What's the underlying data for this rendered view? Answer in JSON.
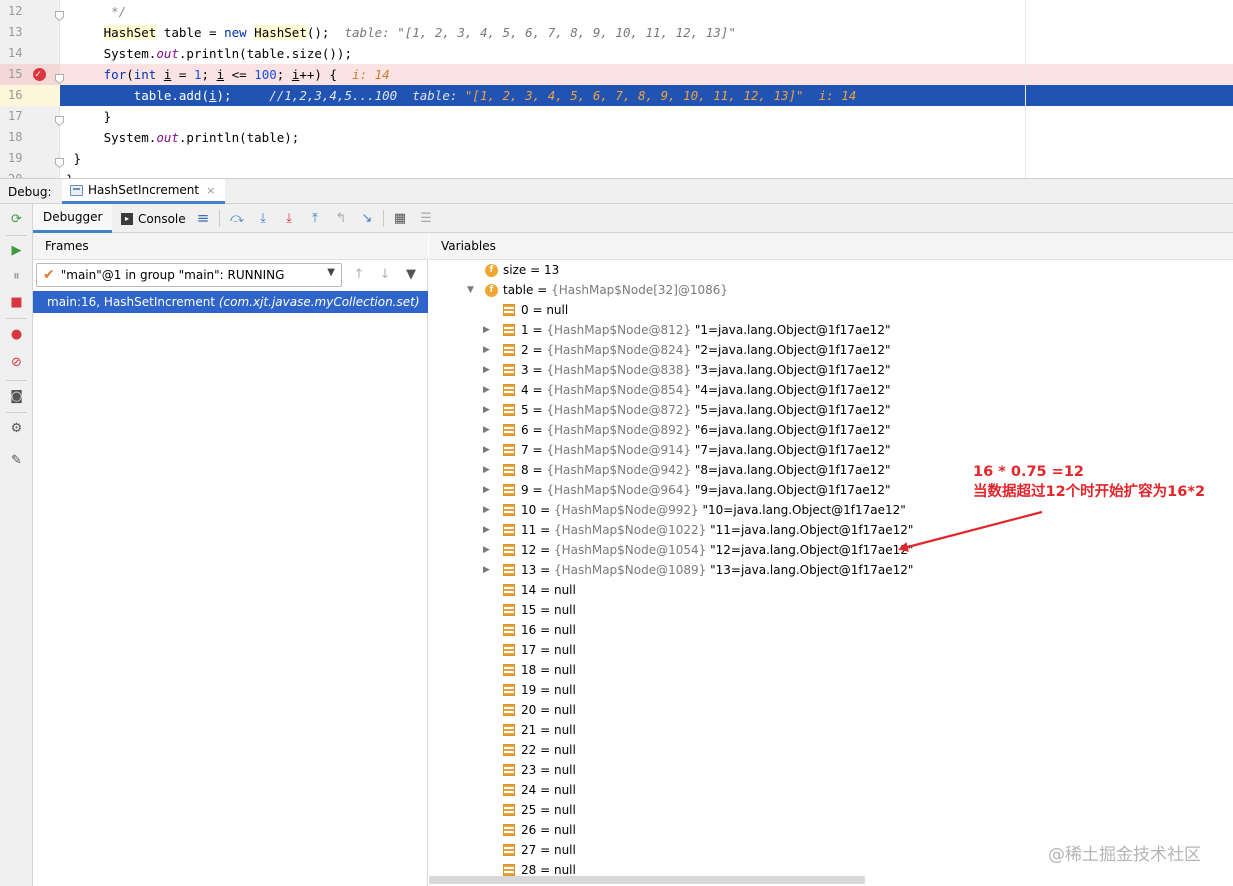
{
  "editor": {
    "lines": [
      {
        "num": "12",
        "parts": [
          {
            "t": "      */",
            "c": "cm"
          }
        ]
      },
      {
        "num": "13",
        "parts": [
          {
            "t": "     "
          },
          {
            "t": "HashSet",
            "c": "ty"
          },
          {
            "t": " table = "
          },
          {
            "t": "new",
            "c": "kw"
          },
          {
            "t": " "
          },
          {
            "t": "HashSet",
            "c": "ty"
          },
          {
            "t": "();  "
          },
          {
            "t": "table: ",
            "c": "hint"
          },
          {
            "t": "\"[1, 2, 3, 4, 5, 6, 7, 8, 9, 10, 11, 12, 13]\"",
            "c": "hint"
          }
        ]
      },
      {
        "num": "14",
        "parts": [
          {
            "t": "     System."
          },
          {
            "t": "out",
            "c": "fld"
          },
          {
            "t": ".println(table.size());"
          }
        ]
      },
      {
        "num": "15",
        "parts": [
          {
            "t": "     "
          },
          {
            "t": "for",
            "c": "kw"
          },
          {
            "t": "("
          },
          {
            "t": "int",
            "c": "kw"
          },
          {
            "t": " "
          },
          {
            "t": "i",
            "c": "uvar"
          },
          {
            "t": " = "
          },
          {
            "t": "1",
            "c": "num"
          },
          {
            "t": "; "
          },
          {
            "t": "i",
            "c": "uvar"
          },
          {
            "t": " <= "
          },
          {
            "t": "100",
            "c": "num"
          },
          {
            "t": "; "
          },
          {
            "t": "i",
            "c": "uvar"
          },
          {
            "t": "++) {  "
          },
          {
            "t": "i: 14",
            "c": "hint-i"
          }
        ]
      },
      {
        "num": "16",
        "parts": [
          {
            "t": "         table.add("
          },
          {
            "t": "i",
            "c": "uvar"
          },
          {
            "t": ");     "
          },
          {
            "t": "//1,2,3,4,5...100",
            "c": "cm"
          },
          {
            "t": "  "
          },
          {
            "t": "table: ",
            "c": "hint"
          },
          {
            "t": "\"[1, 2, 3, 4, 5, 6, 7, 8, 9, 10, 11, 12, 13]\"",
            "c": "hintv"
          },
          {
            "t": "  "
          },
          {
            "t": "i: 14",
            "c": "hint-i"
          }
        ]
      },
      {
        "num": "17",
        "parts": [
          {
            "t": "     }"
          }
        ]
      },
      {
        "num": "18",
        "parts": [
          {
            "t": "     System."
          },
          {
            "t": "out",
            "c": "fld"
          },
          {
            "t": ".println(table);"
          }
        ]
      },
      {
        "num": "19",
        "parts": [
          {
            "t": " }"
          }
        ]
      },
      {
        "num": "20",
        "parts": [
          {
            "t": "}"
          }
        ]
      }
    ]
  },
  "debug": {
    "title": "Debug:",
    "session_tab": "HashSetIncrement",
    "close_glyph": "×",
    "tabs": {
      "debugger": "Debugger",
      "console": "Console"
    }
  },
  "frames": {
    "title": "Frames",
    "thread": "\"main\"@1 in group \"main\": RUNNING",
    "frame_method": "main:16, HashSetIncrement ",
    "frame_package": "(com.xjt.javase.myCollection.set)"
  },
  "variables": {
    "title": "Variables",
    "size": {
      "name": "size",
      "eq": " = ",
      "value": "13"
    },
    "table": {
      "name": "table",
      "eq": " = ",
      "type": "{HashMap$Node[32]@1086}"
    },
    "entries": [
      {
        "name": "0",
        "value": "null"
      },
      {
        "name": "1",
        "type": "{HashMap$Node@812}",
        "value": "\"1=java.lang.Object@1f17ae12\""
      },
      {
        "name": "2",
        "type": "{HashMap$Node@824}",
        "value": "\"2=java.lang.Object@1f17ae12\""
      },
      {
        "name": "3",
        "type": "{HashMap$Node@838}",
        "value": "\"3=java.lang.Object@1f17ae12\""
      },
      {
        "name": "4",
        "type": "{HashMap$Node@854}",
        "value": "\"4=java.lang.Object@1f17ae12\""
      },
      {
        "name": "5",
        "type": "{HashMap$Node@872}",
        "value": "\"5=java.lang.Object@1f17ae12\""
      },
      {
        "name": "6",
        "type": "{HashMap$Node@892}",
        "value": "\"6=java.lang.Object@1f17ae12\""
      },
      {
        "name": "7",
        "type": "{HashMap$Node@914}",
        "value": "\"7=java.lang.Object@1f17ae12\""
      },
      {
        "name": "8",
        "type": "{HashMap$Node@942}",
        "value": "\"8=java.lang.Object@1f17ae12\""
      },
      {
        "name": "9",
        "type": "{HashMap$Node@964}",
        "value": "\"9=java.lang.Object@1f17ae12\""
      },
      {
        "name": "10",
        "type": "{HashMap$Node@992}",
        "value": "\"10=java.lang.Object@1f17ae12\""
      },
      {
        "name": "11",
        "type": "{HashMap$Node@1022}",
        "value": "\"11=java.lang.Object@1f17ae12\""
      },
      {
        "name": "12",
        "type": "{HashMap$Node@1054}",
        "value": "\"12=java.lang.Object@1f17ae12\""
      },
      {
        "name": "13",
        "type": "{HashMap$Node@1089}",
        "value": "\"13=java.lang.Object@1f17ae12\""
      },
      {
        "name": "14",
        "value": "null"
      },
      {
        "name": "15",
        "value": "null"
      },
      {
        "name": "16",
        "value": "null"
      },
      {
        "name": "17",
        "value": "null"
      },
      {
        "name": "18",
        "value": "null"
      },
      {
        "name": "19",
        "value": "null"
      },
      {
        "name": "20",
        "value": "null"
      },
      {
        "name": "21",
        "value": "null"
      },
      {
        "name": "22",
        "value": "null"
      },
      {
        "name": "23",
        "value": "null"
      },
      {
        "name": "24",
        "value": "null"
      },
      {
        "name": "25",
        "value": "null"
      },
      {
        "name": "26",
        "value": "null"
      },
      {
        "name": "27",
        "value": "null"
      },
      {
        "name": "28",
        "value": "null"
      }
    ]
  },
  "annotation": {
    "line1": "16 * 0.75 =12",
    "line2": "当数据超过12个时开始扩容为16*2",
    "color": "#e3262c"
  },
  "watermark": "@稀土掘金技术社区"
}
